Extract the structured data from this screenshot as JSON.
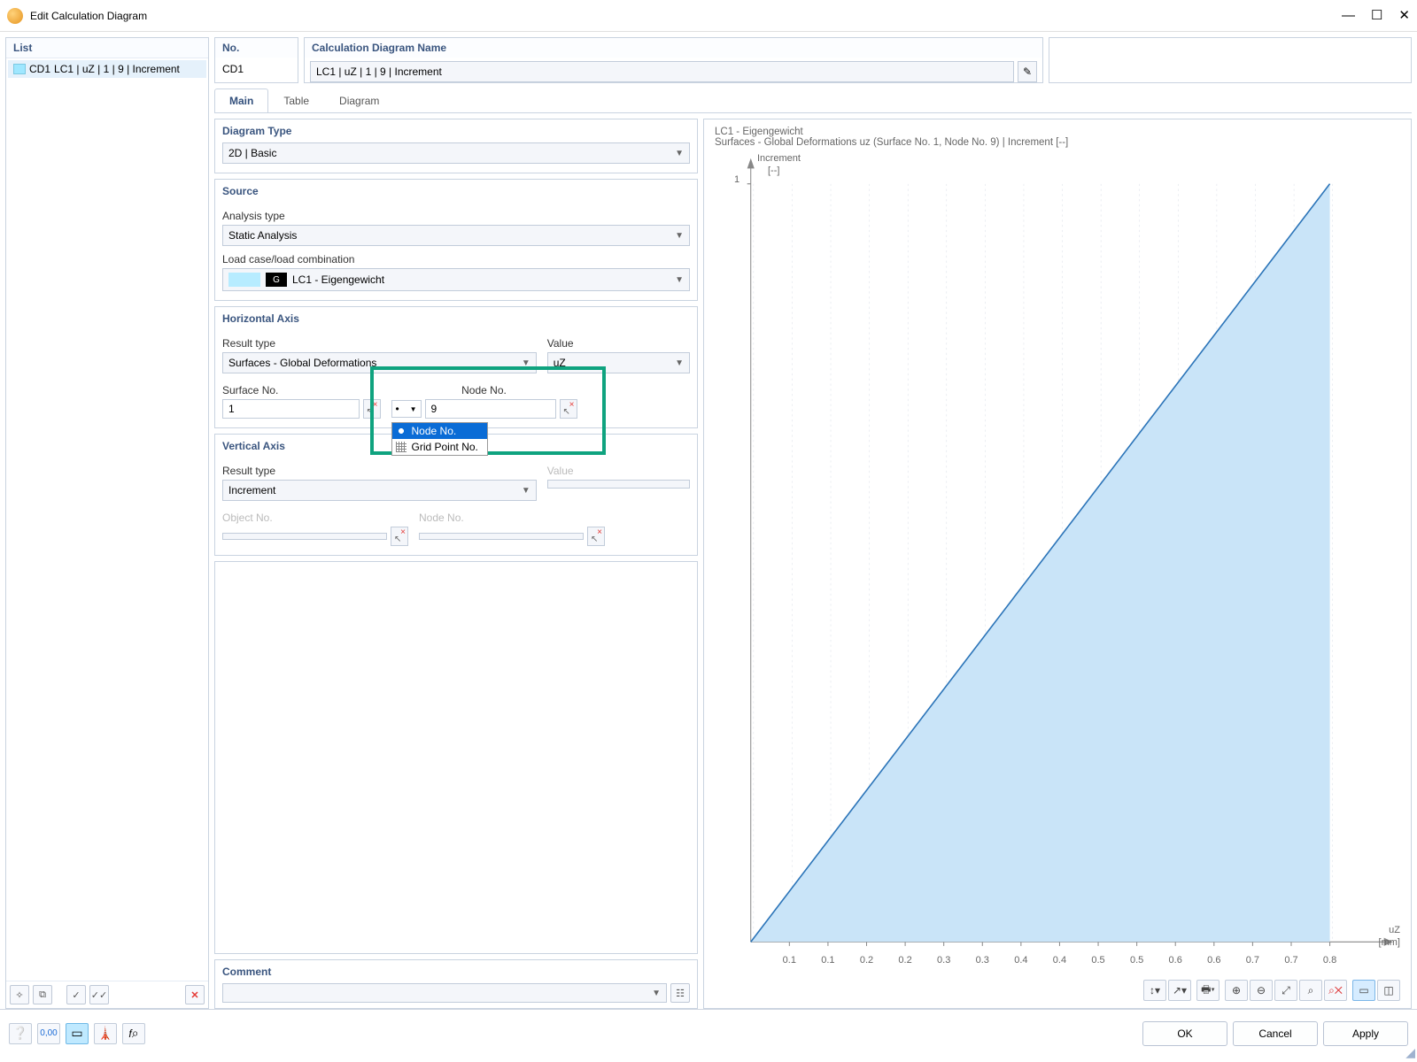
{
  "window": {
    "title": "Edit Calculation Diagram"
  },
  "list": {
    "header": "List",
    "items": [
      {
        "id": "CD1",
        "label": "LC1 | uZ | 1 | 9 | Increment"
      }
    ]
  },
  "no_box": {
    "header": "No.",
    "value": "CD1"
  },
  "name_box": {
    "header": "Calculation Diagram Name",
    "value": "LC1 | uZ | 1 | 9 | Increment"
  },
  "tabs": {
    "main": "Main",
    "table": "Table",
    "diagram": "Diagram",
    "active": "main"
  },
  "diagram_type": {
    "title": "Diagram Type",
    "value": "2D | Basic"
  },
  "source": {
    "title": "Source",
    "analysis_type_label": "Analysis type",
    "analysis_type_value": "Static Analysis",
    "load_case_label": "Load case/load combination",
    "load_case_badge": "G",
    "load_case_value": "LC1 - Eigengewicht"
  },
  "horizontal_axis": {
    "title": "Horizontal Axis",
    "result_type_label": "Result type",
    "result_type_value": "Surfaces - Global Deformations",
    "value_label": "Value",
    "value_value": "uZ",
    "surface_no_label": "Surface No.",
    "surface_no_value": "1",
    "node_no_label": "Node No.",
    "node_sel_symbol": "•",
    "node_no_value": "9",
    "dropdown_opts": [
      "Node No.",
      "Grid Point No."
    ],
    "dropdown_selected": 0
  },
  "vertical_axis": {
    "title": "Vertical Axis",
    "result_type_label": "Result type",
    "result_type_value": "Increment",
    "value_label": "Value",
    "object_no_label": "Object No.",
    "node_no_label": "Node No."
  },
  "comment": {
    "title": "Comment"
  },
  "chart": {
    "header_line1": "LC1 - Eigengewicht",
    "header_line2": "Surfaces - Global Deformations uz (Surface No. 1, Node No. 9) | Increment [--]",
    "y_axis_label": "Increment",
    "y_axis_unit": "[--]",
    "y_tick": "1",
    "x_axis_label": "uZ",
    "x_axis_unit": "[mm]",
    "x_ticks": [
      "0.1",
      "0.1",
      "0.2",
      "0.2",
      "0.3",
      "0.3",
      "0.4",
      "0.4",
      "0.5",
      "0.5",
      "0.6",
      "0.6",
      "0.7",
      "0.7",
      "0.8"
    ]
  },
  "chart_data": {
    "type": "area",
    "title": "Surfaces - Global Deformations uz (Surface No. 1, Node No. 9) | Increment [--]",
    "xlabel": "uZ [mm]",
    "ylabel": "Increment [--]",
    "xlim": [
      0,
      0.85
    ],
    "ylim": [
      0,
      1
    ],
    "x": [
      0,
      0.85
    ],
    "values": [
      0,
      1
    ],
    "series": [
      {
        "name": "Increment",
        "values": [
          0,
          1
        ]
      }
    ]
  },
  "footer": {
    "ok": "OK",
    "cancel": "Cancel",
    "apply": "Apply"
  }
}
